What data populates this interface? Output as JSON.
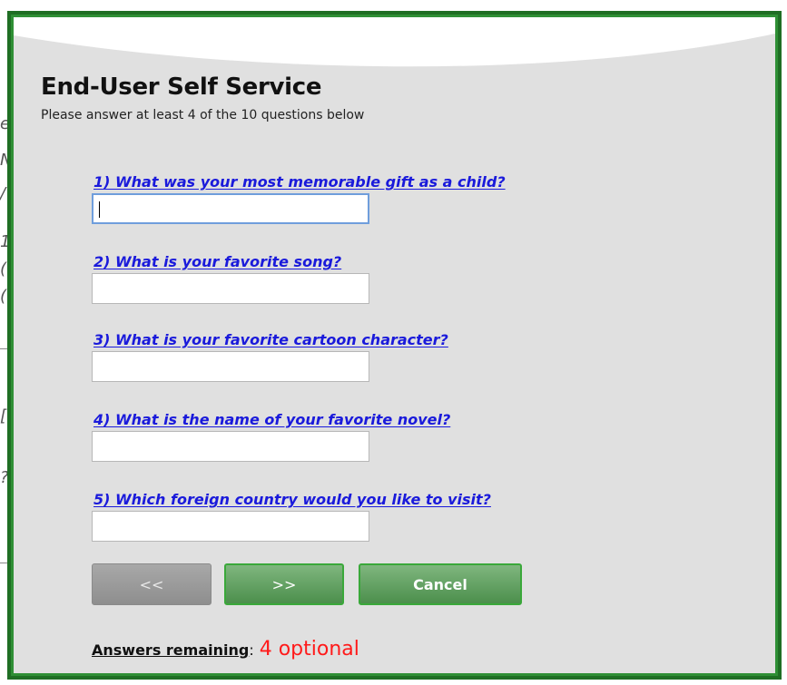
{
  "dialog": {
    "title": "End-User Self Service",
    "subtitle": "Please answer at least 4 of the 10 questions below"
  },
  "questions": [
    {
      "label": "1) What was your most memorable gift as a child?",
      "value": "",
      "focused": true
    },
    {
      "label": "2) What is your favorite song?",
      "value": ""
    },
    {
      "label": "3) What is your favorite cartoon character?",
      "value": ""
    },
    {
      "label": "4) What is the name of your favorite novel?",
      "value": ""
    },
    {
      "label": "5) Which foreign country would you like to visit?",
      "value": ""
    }
  ],
  "buttons": {
    "prev_label": "<<",
    "next_label": ">>",
    "cancel_label": "Cancel"
  },
  "status": {
    "remaining_label": "Answers remaining",
    "remaining_separator": ":",
    "remaining_value": "4 optional"
  },
  "colors": {
    "frame_green": "#1f6e24",
    "question_blue": "#1a1adb",
    "remaining_red": "#ff1a1a",
    "panel_gray": "#e0e0e0"
  }
}
